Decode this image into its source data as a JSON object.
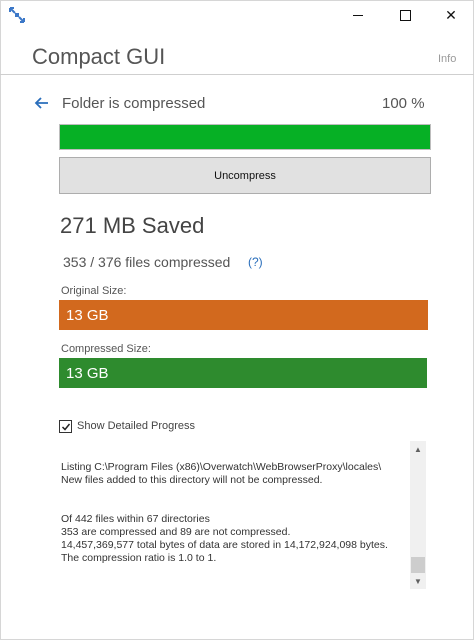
{
  "window": {
    "icons": {
      "app": "compact-arrows-icon",
      "minimize": "minimize-icon",
      "maximize": "maximize-icon",
      "close": "close-icon"
    },
    "close_glyph": "✕"
  },
  "header": {
    "title": "Compact GUI",
    "info_label": "Info"
  },
  "status": {
    "back_icon": "back-arrow-icon",
    "text": "Folder is compressed",
    "percent_label": "100 %",
    "progress_fraction": 1.0,
    "progress_color": "#06b025"
  },
  "actions": {
    "uncompress_label": "Uncompress"
  },
  "summary": {
    "saved_label": "271 MB Saved",
    "files_compressed_label": "353 / 376 files compressed",
    "help_label": "(?)"
  },
  "sizes": {
    "original_label": "Original Size:",
    "original_value": "13 GB",
    "original_color": "#d2691e",
    "compressed_label": "Compressed Size:",
    "compressed_value": "13 GB",
    "compressed_color": "#2e8b2e"
  },
  "details": {
    "show_detailed_progress_label": "Show Detailed Progress",
    "show_detailed_progress_checked": true,
    "log_lines": [
      "Listing C:\\Program Files (x86)\\Overwatch\\WebBrowserProxy\\locales\\",
      "New files added to this directory will not be compressed.",
      "Of 442 files within 67 directories",
      "353 are compressed and 89 are not compressed.",
      "14,457,369,577 total bytes of data are stored in 14,172,924,098 bytes.",
      "The compression ratio is 1.0 to 1."
    ]
  }
}
